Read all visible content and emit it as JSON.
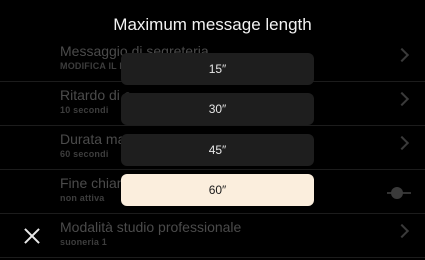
{
  "dialog": {
    "title": "Maximum message length",
    "options": [
      {
        "label": "15″",
        "selected": false
      },
      {
        "label": "30″",
        "selected": false
      },
      {
        "label": "45″",
        "selected": false
      },
      {
        "label": "60″",
        "selected": true
      }
    ]
  },
  "background_list": {
    "items": [
      {
        "title": "Messaggio di segreteria",
        "subtitle": "MODIFICA IL M",
        "control": "chevron-right-icon"
      },
      {
        "title": "Ritardo di a",
        "subtitle": "10 secondi",
        "control": "chevron-right-icon"
      },
      {
        "title": "Durata mas",
        "subtitle": "60 secondi",
        "control": "chevron-right-icon"
      },
      {
        "title": "Fine chiam",
        "subtitle": "non attiva",
        "control": "toggle"
      },
      {
        "title": "Modalità studio professionale",
        "subtitle": "suoneria 1",
        "control": "chevron-right-icon"
      }
    ]
  },
  "close": {
    "icon": "close-icon"
  },
  "colors": {
    "background": "#000000",
    "option_bg": "#1e1e1e",
    "option_selected_bg": "#fbeedd"
  }
}
